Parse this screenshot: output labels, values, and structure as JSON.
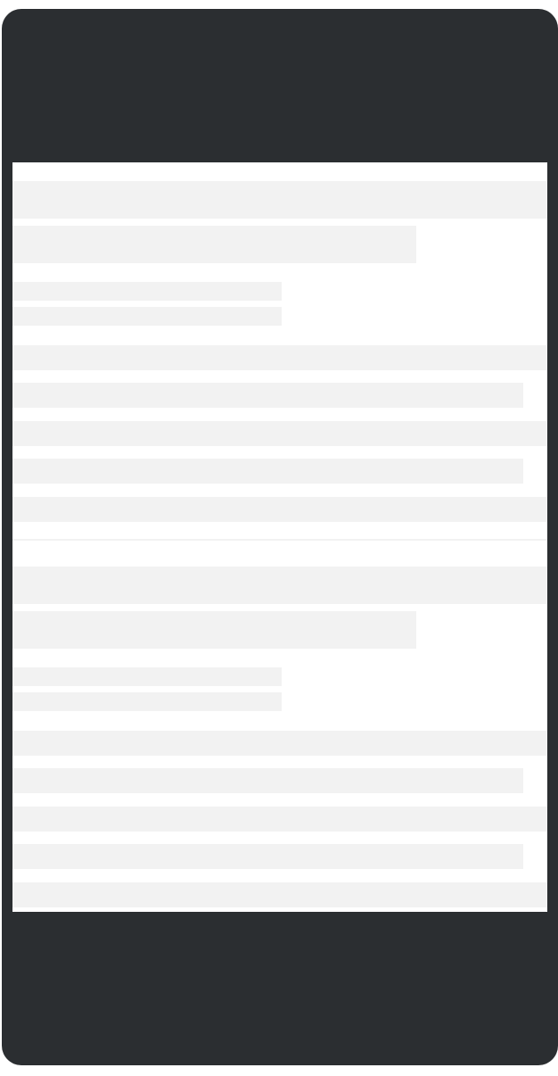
{
  "app": {
    "state": "loading",
    "colors": {
      "device_frame": "#2b2e31",
      "screen_background": "#ffffff",
      "skeleton_placeholder": "#f2f2f2"
    }
  },
  "feed": {
    "cards": [
      {
        "skeleton": [
          "title",
          "subtitle",
          "meta-line",
          "meta-line",
          "body-line",
          "body-line",
          "body-line",
          "body-line",
          "body-line"
        ]
      },
      {
        "skeleton": [
          "title",
          "subtitle",
          "meta-line",
          "meta-line",
          "body-line",
          "body-line",
          "body-line",
          "body-line",
          "body-line"
        ]
      }
    ]
  }
}
